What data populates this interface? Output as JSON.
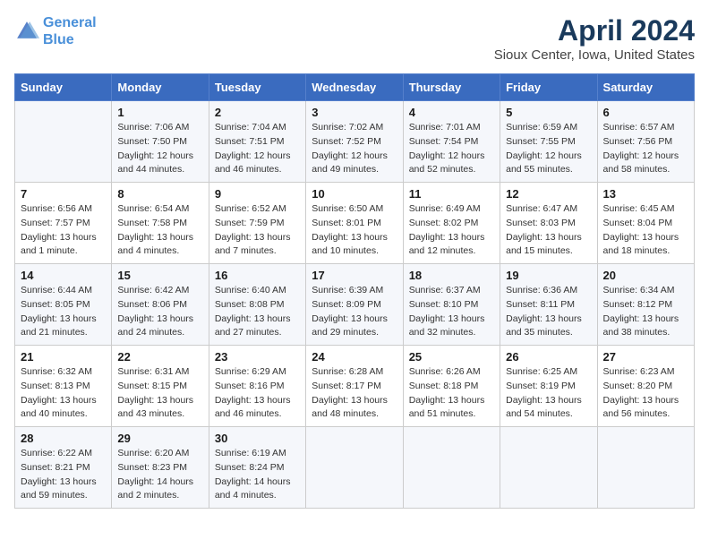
{
  "logo": {
    "line1": "General",
    "line2": "Blue"
  },
  "title": "April 2024",
  "subtitle": "Sioux Center, Iowa, United States",
  "days_of_week": [
    "Sunday",
    "Monday",
    "Tuesday",
    "Wednesday",
    "Thursday",
    "Friday",
    "Saturday"
  ],
  "weeks": [
    [
      {
        "num": "",
        "info": ""
      },
      {
        "num": "1",
        "info": "Sunrise: 7:06 AM\nSunset: 7:50 PM\nDaylight: 12 hours\nand 44 minutes."
      },
      {
        "num": "2",
        "info": "Sunrise: 7:04 AM\nSunset: 7:51 PM\nDaylight: 12 hours\nand 46 minutes."
      },
      {
        "num": "3",
        "info": "Sunrise: 7:02 AM\nSunset: 7:52 PM\nDaylight: 12 hours\nand 49 minutes."
      },
      {
        "num": "4",
        "info": "Sunrise: 7:01 AM\nSunset: 7:54 PM\nDaylight: 12 hours\nand 52 minutes."
      },
      {
        "num": "5",
        "info": "Sunrise: 6:59 AM\nSunset: 7:55 PM\nDaylight: 12 hours\nand 55 minutes."
      },
      {
        "num": "6",
        "info": "Sunrise: 6:57 AM\nSunset: 7:56 PM\nDaylight: 12 hours\nand 58 minutes."
      }
    ],
    [
      {
        "num": "7",
        "info": "Sunrise: 6:56 AM\nSunset: 7:57 PM\nDaylight: 13 hours\nand 1 minute."
      },
      {
        "num": "8",
        "info": "Sunrise: 6:54 AM\nSunset: 7:58 PM\nDaylight: 13 hours\nand 4 minutes."
      },
      {
        "num": "9",
        "info": "Sunrise: 6:52 AM\nSunset: 7:59 PM\nDaylight: 13 hours\nand 7 minutes."
      },
      {
        "num": "10",
        "info": "Sunrise: 6:50 AM\nSunset: 8:01 PM\nDaylight: 13 hours\nand 10 minutes."
      },
      {
        "num": "11",
        "info": "Sunrise: 6:49 AM\nSunset: 8:02 PM\nDaylight: 13 hours\nand 12 minutes."
      },
      {
        "num": "12",
        "info": "Sunrise: 6:47 AM\nSunset: 8:03 PM\nDaylight: 13 hours\nand 15 minutes."
      },
      {
        "num": "13",
        "info": "Sunrise: 6:45 AM\nSunset: 8:04 PM\nDaylight: 13 hours\nand 18 minutes."
      }
    ],
    [
      {
        "num": "14",
        "info": "Sunrise: 6:44 AM\nSunset: 8:05 PM\nDaylight: 13 hours\nand 21 minutes."
      },
      {
        "num": "15",
        "info": "Sunrise: 6:42 AM\nSunset: 8:06 PM\nDaylight: 13 hours\nand 24 minutes."
      },
      {
        "num": "16",
        "info": "Sunrise: 6:40 AM\nSunset: 8:08 PM\nDaylight: 13 hours\nand 27 minutes."
      },
      {
        "num": "17",
        "info": "Sunrise: 6:39 AM\nSunset: 8:09 PM\nDaylight: 13 hours\nand 29 minutes."
      },
      {
        "num": "18",
        "info": "Sunrise: 6:37 AM\nSunset: 8:10 PM\nDaylight: 13 hours\nand 32 minutes."
      },
      {
        "num": "19",
        "info": "Sunrise: 6:36 AM\nSunset: 8:11 PM\nDaylight: 13 hours\nand 35 minutes."
      },
      {
        "num": "20",
        "info": "Sunrise: 6:34 AM\nSunset: 8:12 PM\nDaylight: 13 hours\nand 38 minutes."
      }
    ],
    [
      {
        "num": "21",
        "info": "Sunrise: 6:32 AM\nSunset: 8:13 PM\nDaylight: 13 hours\nand 40 minutes."
      },
      {
        "num": "22",
        "info": "Sunrise: 6:31 AM\nSunset: 8:15 PM\nDaylight: 13 hours\nand 43 minutes."
      },
      {
        "num": "23",
        "info": "Sunrise: 6:29 AM\nSunset: 8:16 PM\nDaylight: 13 hours\nand 46 minutes."
      },
      {
        "num": "24",
        "info": "Sunrise: 6:28 AM\nSunset: 8:17 PM\nDaylight: 13 hours\nand 48 minutes."
      },
      {
        "num": "25",
        "info": "Sunrise: 6:26 AM\nSunset: 8:18 PM\nDaylight: 13 hours\nand 51 minutes."
      },
      {
        "num": "26",
        "info": "Sunrise: 6:25 AM\nSunset: 8:19 PM\nDaylight: 13 hours\nand 54 minutes."
      },
      {
        "num": "27",
        "info": "Sunrise: 6:23 AM\nSunset: 8:20 PM\nDaylight: 13 hours\nand 56 minutes."
      }
    ],
    [
      {
        "num": "28",
        "info": "Sunrise: 6:22 AM\nSunset: 8:21 PM\nDaylight: 13 hours\nand 59 minutes."
      },
      {
        "num": "29",
        "info": "Sunrise: 6:20 AM\nSunset: 8:23 PM\nDaylight: 14 hours\nand 2 minutes."
      },
      {
        "num": "30",
        "info": "Sunrise: 6:19 AM\nSunset: 8:24 PM\nDaylight: 14 hours\nand 4 minutes."
      },
      {
        "num": "",
        "info": ""
      },
      {
        "num": "",
        "info": ""
      },
      {
        "num": "",
        "info": ""
      },
      {
        "num": "",
        "info": ""
      }
    ]
  ]
}
